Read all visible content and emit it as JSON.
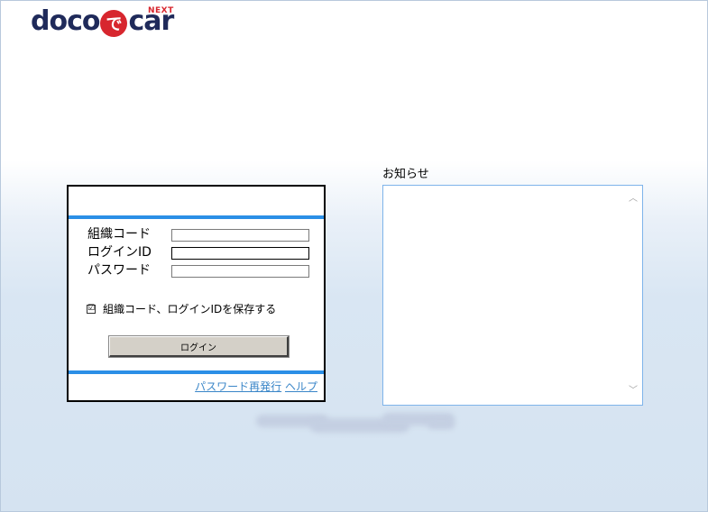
{
  "logo": {
    "text_before": "doco",
    "badge": "で",
    "text_after": "car",
    "superscript": "NEXT"
  },
  "login": {
    "fields": [
      {
        "label": "組織コード",
        "value": "",
        "placeholder": ""
      },
      {
        "label": "ログインID",
        "value": "",
        "placeholder": ""
      },
      {
        "label": "パスワード",
        "value": "",
        "placeholder": ""
      }
    ],
    "remember_label": "組織コード、ログインIDを保存する",
    "remember_checked": true,
    "remember_mark": "☑",
    "button_label": "ログイン",
    "links": {
      "reset_password": "パスワード再発行",
      "help": "ヘルプ"
    }
  },
  "notice": {
    "title": "お知らせ",
    "up_arrow": "︿",
    "down_arrow": "﹀"
  },
  "colors": {
    "accent_blue": "#2b8fe6",
    "logo_navy": "#1f2a5a",
    "logo_red": "#d7262e",
    "link_blue": "#3a86c8"
  }
}
